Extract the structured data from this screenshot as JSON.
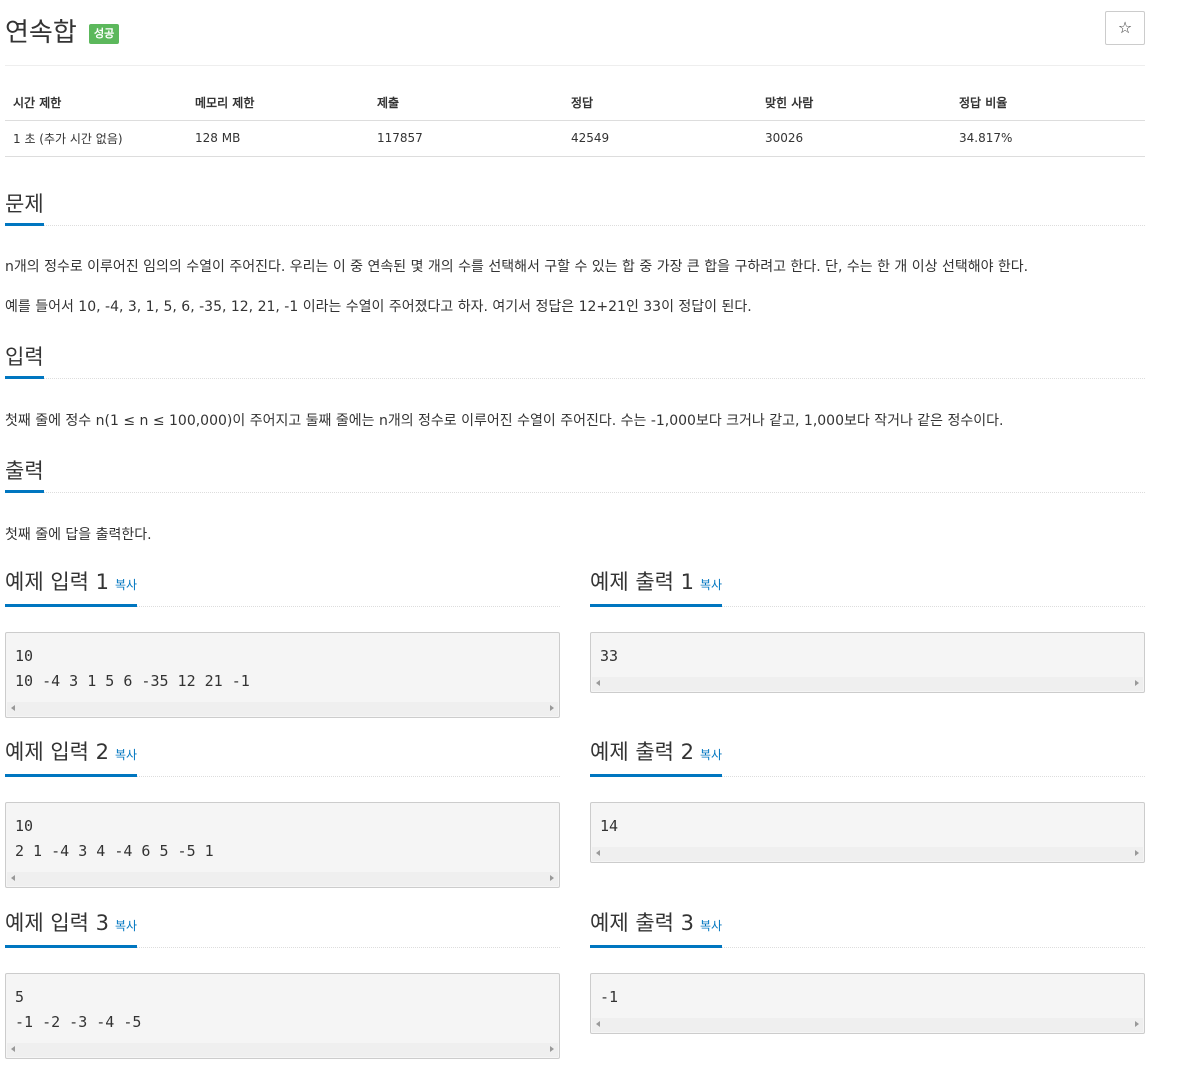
{
  "problem": {
    "title": "연속합",
    "badge": "성공",
    "star_icon": "☆"
  },
  "info": {
    "headers": [
      "시간 제한",
      "메모리 제한",
      "제출",
      "정답",
      "맞힌 사람",
      "정답 비율"
    ],
    "values": [
      "1 초 (추가 시간 없음)",
      "128 MB",
      "117857",
      "42549",
      "30026",
      "34.817%"
    ]
  },
  "sections": {
    "problem_heading": "문제",
    "problem_text_1": "n개의 정수로 이루어진 임의의 수열이 주어진다. 우리는 이 중 연속된 몇 개의 수를 선택해서 구할 수 있는 합 중 가장 큰 합을 구하려고 한다. 단, 수는 한 개 이상 선택해야 한다.",
    "problem_text_2": "예를 들어서 10, -4, 3, 1, 5, 6, -35, 12, 21, -1 이라는 수열이 주어졌다고 하자. 여기서 정답은 12+21인 33이 정답이 된다.",
    "input_heading": "입력",
    "input_text": "첫째 줄에 정수 n(1 ≤ n ≤ 100,000)이 주어지고 둘째 줄에는 n개의 정수로 이루어진 수열이 주어진다. 수는 -1,000보다 크거나 같고, 1,000보다 작거나 같은 정수이다.",
    "output_heading": "출력",
    "output_text": "첫째 줄에 답을 출력한다."
  },
  "samples": [
    {
      "input_title": "예제 입력 1",
      "output_title": "예제 출력 1",
      "copy": "복사",
      "input_lines": [
        "10",
        "10 -4 3 1 5 6 -35 12 21 -1"
      ],
      "output_lines": [
        "33"
      ]
    },
    {
      "input_title": "예제 입력 2",
      "output_title": "예제 출력 2",
      "copy": "복사",
      "input_lines": [
        "10",
        "2 1 -4 3 4 -4 6 5 -5 1"
      ],
      "output_lines": [
        "14"
      ]
    },
    {
      "input_title": "예제 입력 3",
      "output_title": "예제 출력 3",
      "copy": "복사",
      "input_lines": [
        "5",
        "-1 -2 -3 -4 -5"
      ],
      "output_lines": [
        "-1"
      ]
    }
  ]
}
